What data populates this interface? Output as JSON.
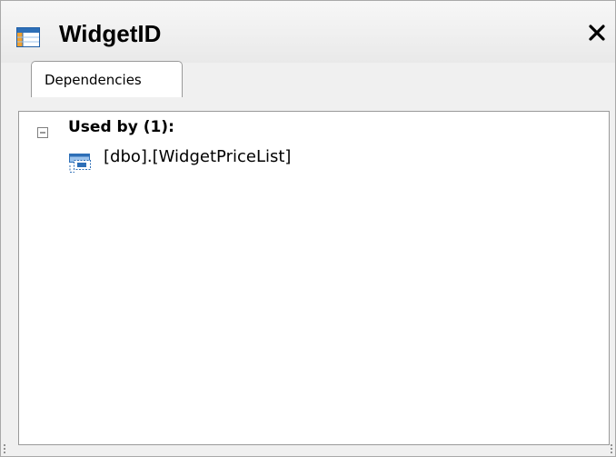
{
  "window": {
    "title": "WidgetID",
    "title_icon": "table-icon",
    "close_icon": "close-icon"
  },
  "tabs": [
    {
      "label": "Dependencies",
      "active": true
    }
  ],
  "tree": {
    "group": {
      "label": "Used by (1):",
      "expander_icon": "collapse-minus-icon",
      "expanded": true
    },
    "items": [
      {
        "label": "[dbo].[WidgetPriceList]",
        "icon": "view-icon"
      }
    ]
  },
  "colors": {
    "border": "#9a9a9a",
    "header_bg": "#f0f0f0",
    "icon_blue": "#2e6fb7",
    "icon_light_blue": "#9cc3ec"
  }
}
